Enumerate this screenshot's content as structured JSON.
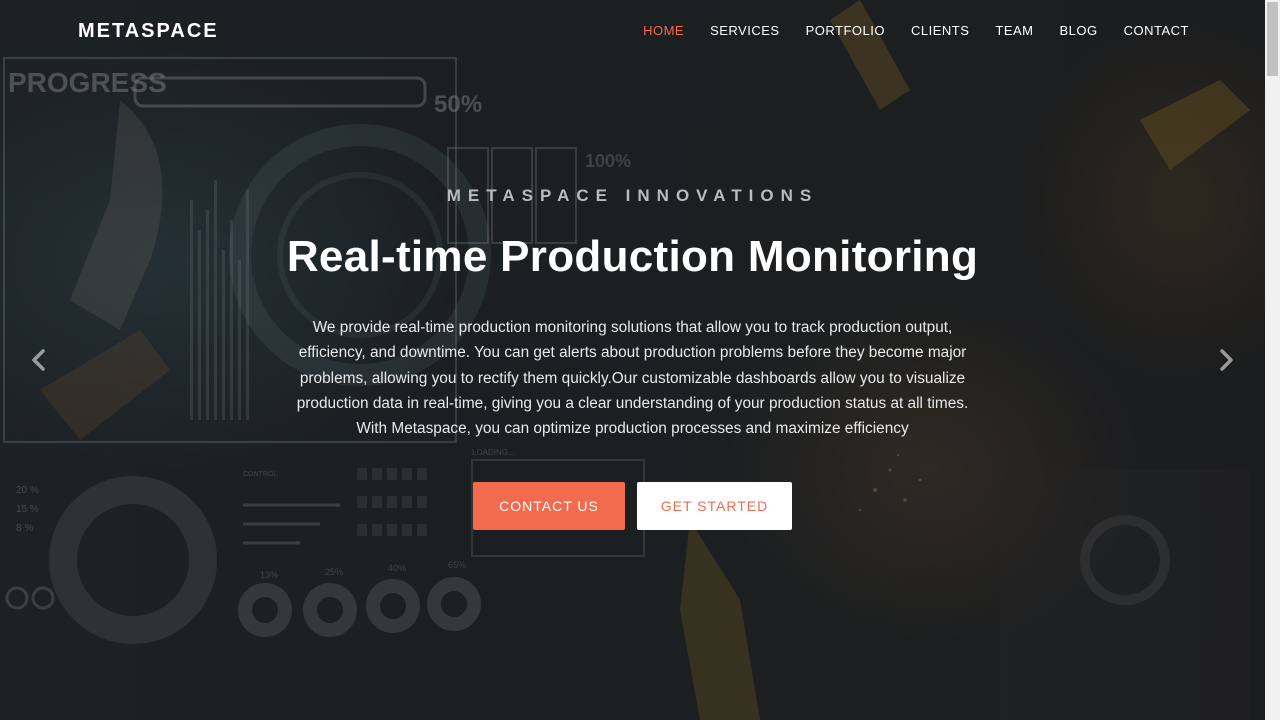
{
  "brand": {
    "name": "METASPACE"
  },
  "nav": {
    "items": [
      {
        "label": "HOME",
        "active": true
      },
      {
        "label": "SERVICES",
        "active": false
      },
      {
        "label": "PORTFOLIO",
        "active": false
      },
      {
        "label": "CLIENTS",
        "active": false
      },
      {
        "label": "TEAM",
        "active": false
      },
      {
        "label": "BLOG",
        "active": false
      },
      {
        "label": "CONTACT",
        "active": false
      }
    ]
  },
  "hero": {
    "eyebrow": "METASPACE INNOVATIONS",
    "title": "Real-time Production Monitoring",
    "description": "We provide real-time production monitoring solutions that allow you to track production output, efficiency, and downtime. You can get alerts about production problems before they become major problems, allowing you to rectify them quickly.Our customizable dashboards allow you to visualize production data in real-time, giving you a clear understanding of your production status at all times. With Metaspace, you can optimize production processes and maximize efficiency",
    "primary_button": "CONTACT US",
    "secondary_button": "GET STARTED",
    "prev_icon": "chevron-left-icon",
    "next_icon": "chevron-right-icon"
  },
  "background_text": {
    "progress_label": "PROGRESS",
    "progress_value": "50%",
    "top_value": "100%",
    "loading_label": "LOADING...",
    "control_label": "CONTROL",
    "pcts_left": [
      "20 %",
      "15 %",
      "8 %"
    ],
    "ring_values": [
      "13%",
      "25%",
      "40%",
      "65%"
    ]
  },
  "colors": {
    "accent": "#f26b4f",
    "text": "#ffffff",
    "eyebrow": "#b8bcbf"
  }
}
